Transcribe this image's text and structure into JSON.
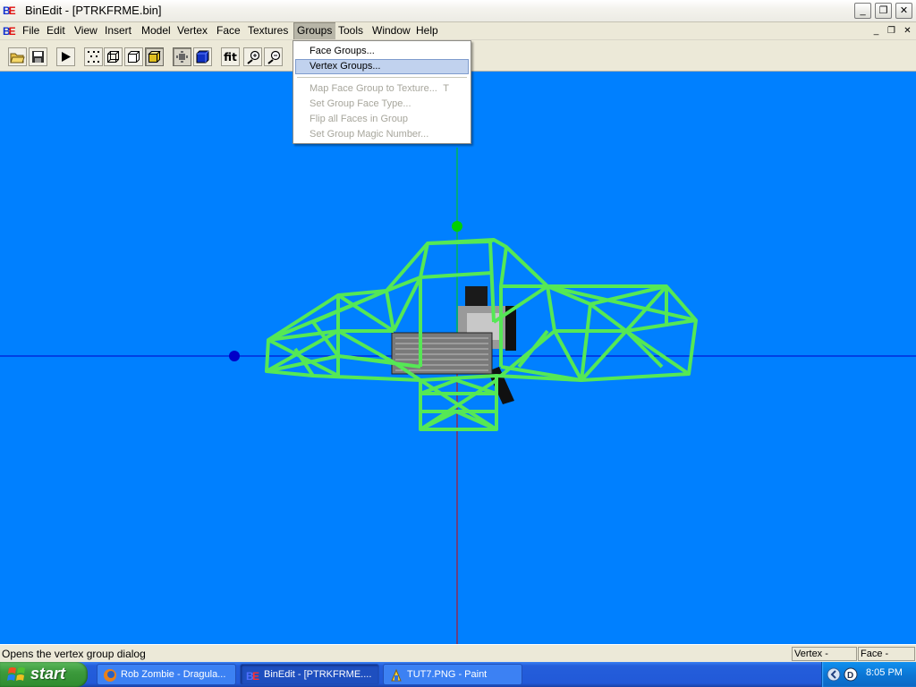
{
  "window": {
    "title": "BinEdit - [PTRKFRME.bin]",
    "logo_b": "B",
    "logo_e": "E",
    "controls": {
      "minimize": "_",
      "maximize": "❐",
      "close": "✕"
    }
  },
  "menubar": {
    "items": [
      "File",
      "Edit",
      "View",
      "Insert",
      "Model",
      "Vertex",
      "Face",
      "Textures",
      "Groups",
      "Tools",
      "Window",
      "Help"
    ],
    "open_menu": "Groups",
    "mdi_controls": {
      "minimize": "_",
      "restore": "❐",
      "close": "✕"
    }
  },
  "toolbar": {
    "buttons": [
      "open-folder-icon",
      "save-disk-icon",
      "play-icon",
      "vertices-icon",
      "wireframe-cube-icon",
      "flat-cube-icon",
      "solid-cube-icon",
      "point-mode-icon",
      "textured-cube-icon",
      "fit",
      "zoom-in-icon",
      "zoom-out-icon"
    ],
    "fit_label": "fit"
  },
  "groups_menu": {
    "items": [
      {
        "label": "Face Groups...",
        "enabled": true,
        "highlighted": false,
        "shortcut": ""
      },
      {
        "label": "Vertex Groups...",
        "enabled": true,
        "highlighted": true,
        "shortcut": ""
      },
      {
        "label": "Map Face Group to Texture...",
        "enabled": false,
        "highlighted": false,
        "shortcut": "T"
      },
      {
        "label": "Set Group Face Type...",
        "enabled": false,
        "highlighted": false,
        "shortcut": ""
      },
      {
        "label": "Flip all Faces in Group",
        "enabled": false,
        "highlighted": false,
        "shortcut": ""
      },
      {
        "label": "Set Group Magic Number...",
        "enabled": false,
        "highlighted": false,
        "shortcut": ""
      }
    ]
  },
  "viewport": {
    "background": "#0080ff",
    "wireframe_color": "#55e855",
    "x_axis_color": "#0000c8",
    "y_axis_color": "#00d000",
    "z_axis_color": "#d00000"
  },
  "statusbar": {
    "message": "Opens the vertex group dialog",
    "vertex_pane": "Vertex - None",
    "face_pane": "Face - None"
  },
  "taskbar": {
    "start_label": "start",
    "tasks": [
      {
        "label": "Rob Zombie - Dragula...",
        "icon": "firefox-icon",
        "active": false
      },
      {
        "label": "BinEdit - [PTRKFRME....",
        "icon": "binedit-icon",
        "active": true
      },
      {
        "label": "TUT7.PNG - Paint",
        "icon": "paint-icon",
        "active": false
      }
    ],
    "clock": "8:05 PM"
  }
}
